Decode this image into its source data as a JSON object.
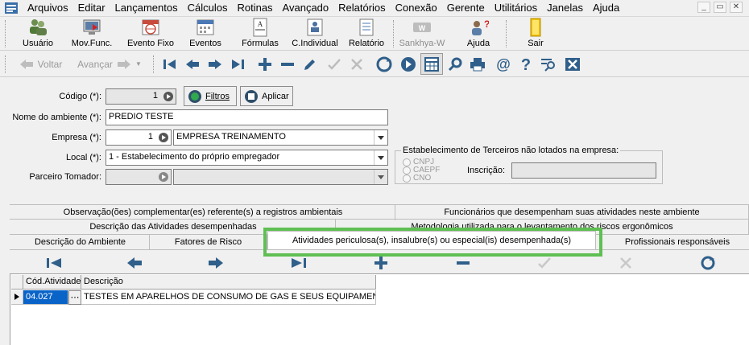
{
  "menu": [
    "Arquivos",
    "Editar",
    "Lançamentos",
    "Cálculos",
    "Rotinas",
    "Avançado",
    "Relatórios",
    "Conexão",
    "Gerente",
    "Utilitários",
    "Janelas",
    "Ajuda"
  ],
  "window_controls": [
    "_",
    "▭",
    "✕"
  ],
  "toolbar1": [
    {
      "label": "Usuário",
      "icon": "users-icon"
    },
    {
      "label": "Mov.Func.",
      "icon": "monitor-icon"
    },
    {
      "label": "Evento Fixo",
      "icon": "calendar-globe-icon"
    },
    {
      "label": "Eventos",
      "icon": "calendar-icon"
    },
    {
      "label": "Fórmulas",
      "icon": "formula-icon"
    },
    {
      "label": "C.Individual",
      "icon": "person-card-icon"
    },
    {
      "label": "Relatório",
      "icon": "report-icon"
    },
    {
      "label": "Sankhya-W",
      "icon": "sankhya-icon"
    },
    {
      "label": "Ajuda",
      "icon": "help-person-icon"
    },
    {
      "label": "Sair",
      "icon": "exit-icon"
    }
  ],
  "toolbar2": {
    "back": "Voltar",
    "forward": "Avançar"
  },
  "form": {
    "codigo_label": "Código (*):",
    "codigo_value": "1",
    "filtros": "Filtros",
    "aplicar": "Aplicar",
    "nome_label": "Nome do ambiente (*):",
    "nome_value": "PREDIO TESTE",
    "empresa_label": "Empresa (*):",
    "empresa_code": "1",
    "empresa_name": "EMPRESA TREINAMENTO",
    "local_label": "Local (*):",
    "local_value": "1 - Estabelecimento do próprio empregador",
    "parceiro_label": "Parceiro Tomador:",
    "terceiros_title": "Estabelecimento de Terceiros não lotados na empresa:",
    "radios": [
      "CNPJ",
      "CAEPF",
      "CNO"
    ],
    "inscricao_label": "Inscrição:"
  },
  "tabs": {
    "row1": [
      "Observação(ões) complementar(es) referente(s) a registros ambientais",
      "Funcionários que desempenham suas atividades neste ambiente"
    ],
    "row2": [
      "Descrição das Atividades desempenhadas",
      "Metodologia utilizada para o levantamento dos riscos ergonômicos"
    ],
    "row3": [
      "Descrição do Ambiente",
      "Fatores de Risco",
      "Atividades periculosa(s), insalubre(s) ou especial(is) desempenhada(s)",
      "Profissionais responsáveis"
    ]
  },
  "grid": {
    "columns": [
      "Cód.Atividade",
      "Descrição"
    ],
    "rows": [
      {
        "code": "04.027",
        "desc": "TESTES EM APARELHOS DE CONSUMO DE GAS E SEUS EQUIPAMENTOS (I"
      }
    ]
  },
  "colors": {
    "highlight": "#5fbf53",
    "selected_cell": "#0a64c8",
    "nav_blue": "#2f5f8a",
    "nav_green": "#3a8a3a"
  }
}
